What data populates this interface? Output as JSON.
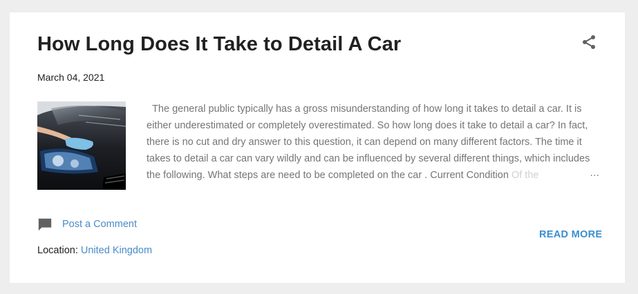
{
  "post": {
    "title": "How Long Does It Take to Detail A Car",
    "date": "March 04, 2021",
    "snippet_main": "The general public typically has a gross misunderstanding of how long it takes to detail a car. It is either underestimated or completely overestimated. So how long does it take to detail a car? In fact, there is no cut and dry answer to this question, it can depend on many different factors. The time it takes to detail a car can vary wildly and can be influenced by several different things, which includes the following. What steps are need to be completed on the car . Current Condition ",
    "snippet_fade": "Of the",
    "ellipsis": "…",
    "comment_label": "Post a Comment",
    "read_more": "READ MORE",
    "location_label": "Location:",
    "location_value": "United Kingdom"
  },
  "icons": {
    "share": "share-icon",
    "comment": "comment-icon"
  },
  "colors": {
    "background": "#eeeeee",
    "card": "#ffffff",
    "title": "#212121",
    "snippet": "#757575",
    "link": "#4a8bc7",
    "read_more": "#3a8ed0",
    "icon": "#616161"
  }
}
